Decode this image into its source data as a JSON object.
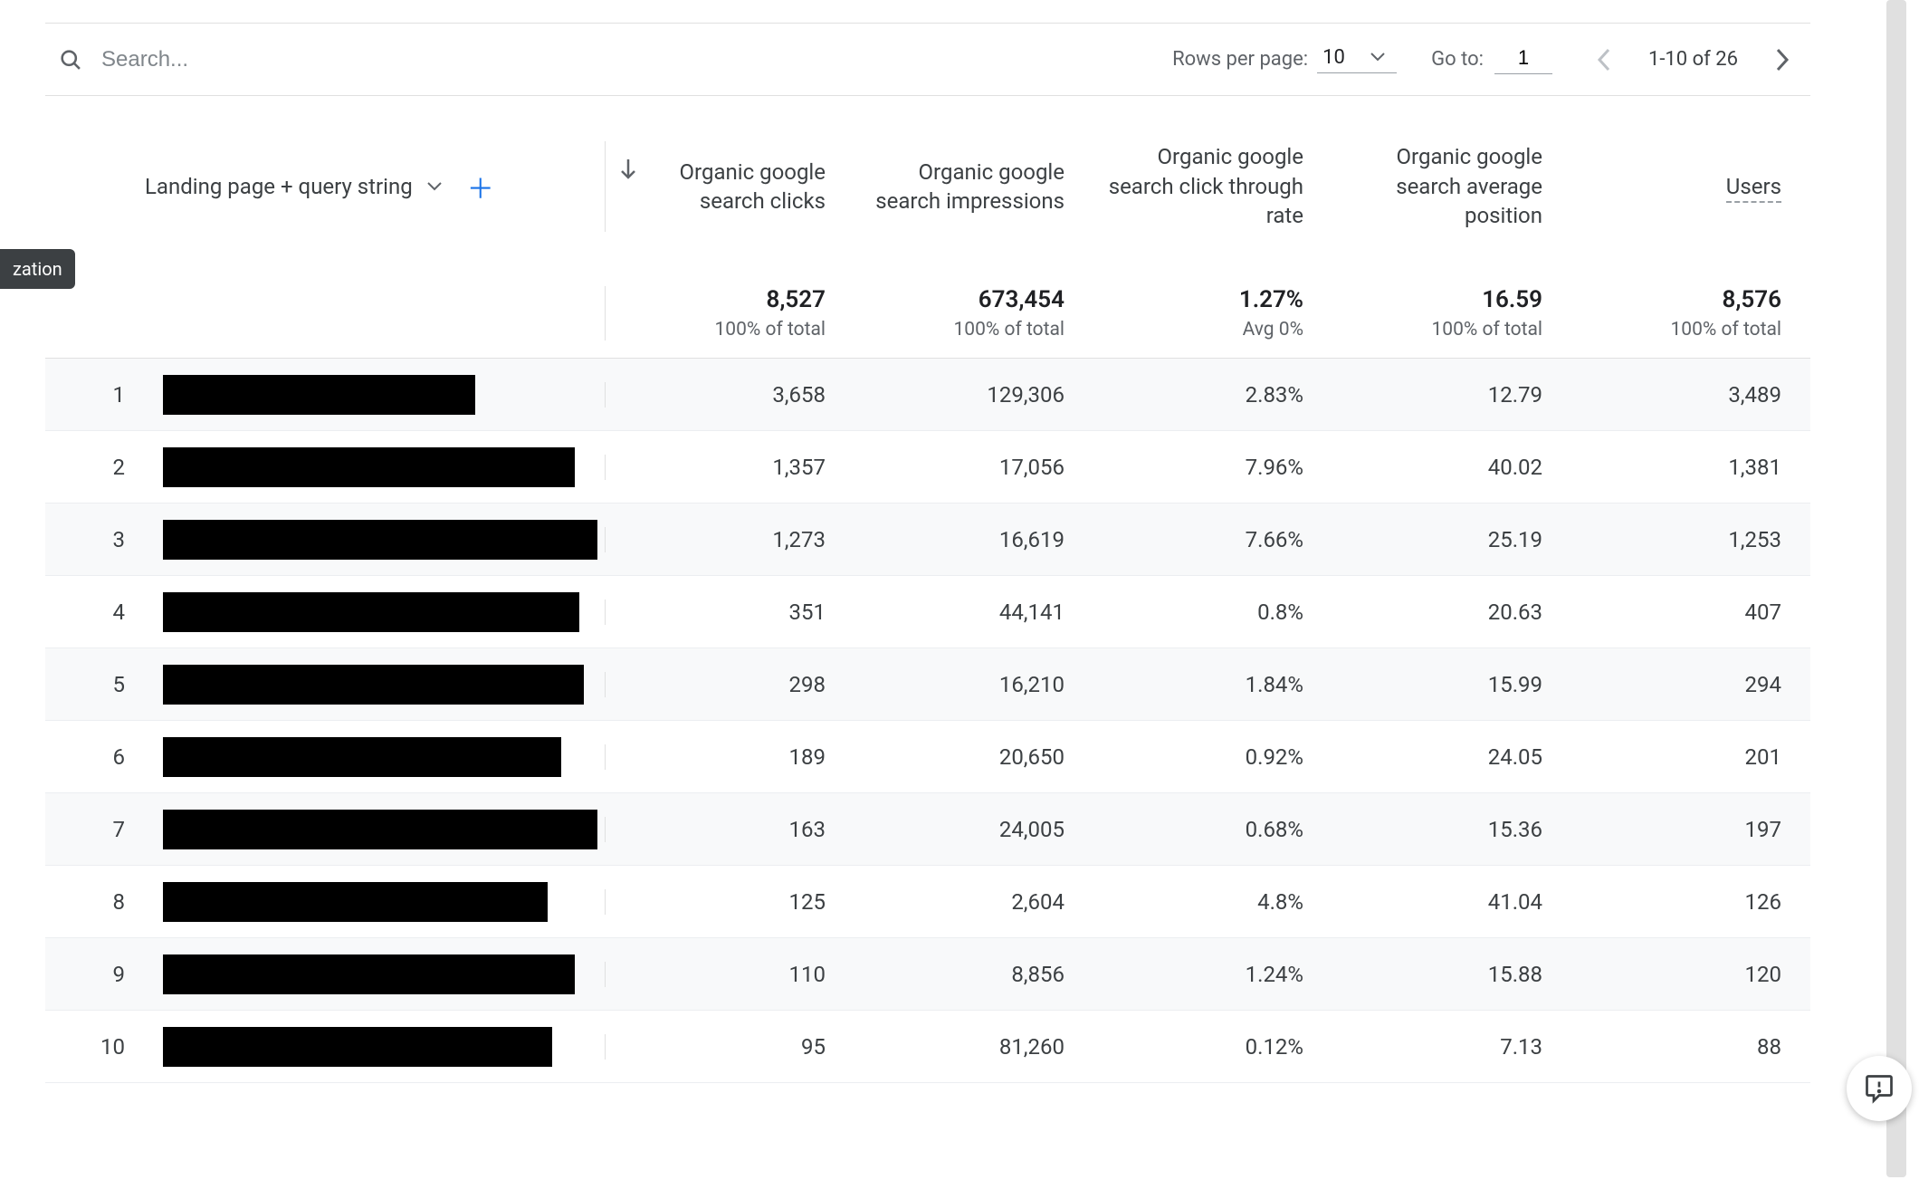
{
  "sideChip": "zation",
  "toolbar": {
    "search_placeholder": "Search...",
    "rows_per_page_label": "Rows per page:",
    "rows_per_page_value": "10",
    "goto_label": "Go to:",
    "goto_value": "1",
    "range_text": "1-10 of 26"
  },
  "dimension": {
    "label": "Landing page + query string"
  },
  "columns": [
    {
      "label": "Organic google search clicks",
      "total": "8,527",
      "sub": "100% of total"
    },
    {
      "label": "Organic google search impressions",
      "total": "673,454",
      "sub": "100% of total"
    },
    {
      "label": "Organic google search click through rate",
      "total": "1.27%",
      "sub": "Avg 0%"
    },
    {
      "label": "Organic google search average position",
      "total": "16.59",
      "sub": "100% of total"
    },
    {
      "label": "Users",
      "total": "8,576",
      "sub": "100% of total"
    }
  ],
  "rows": [
    {
      "redactWidth": 345,
      "values": [
        "3,658",
        "129,306",
        "2.83%",
        "12.79",
        "3,489"
      ]
    },
    {
      "redactWidth": 455,
      "values": [
        "1,357",
        "17,056",
        "7.96%",
        "40.02",
        "1,381"
      ]
    },
    {
      "redactWidth": 480,
      "values": [
        "1,273",
        "16,619",
        "7.66%",
        "25.19",
        "1,253"
      ]
    },
    {
      "redactWidth": 460,
      "values": [
        "351",
        "44,141",
        "0.8%",
        "20.63",
        "407"
      ]
    },
    {
      "redactWidth": 465,
      "values": [
        "298",
        "16,210",
        "1.84%",
        "15.99",
        "294"
      ]
    },
    {
      "redactWidth": 440,
      "values": [
        "189",
        "20,650",
        "0.92%",
        "24.05",
        "201"
      ]
    },
    {
      "redactWidth": 480,
      "values": [
        "163",
        "24,005",
        "0.68%",
        "15.36",
        "197"
      ]
    },
    {
      "redactWidth": 425,
      "values": [
        "125",
        "2,604",
        "4.8%",
        "41.04",
        "126"
      ]
    },
    {
      "redactWidth": 455,
      "values": [
        "110",
        "8,856",
        "1.24%",
        "15.88",
        "120"
      ]
    },
    {
      "redactWidth": 430,
      "values": [
        "95",
        "81,260",
        "0.12%",
        "7.13",
        "88"
      ]
    }
  ]
}
